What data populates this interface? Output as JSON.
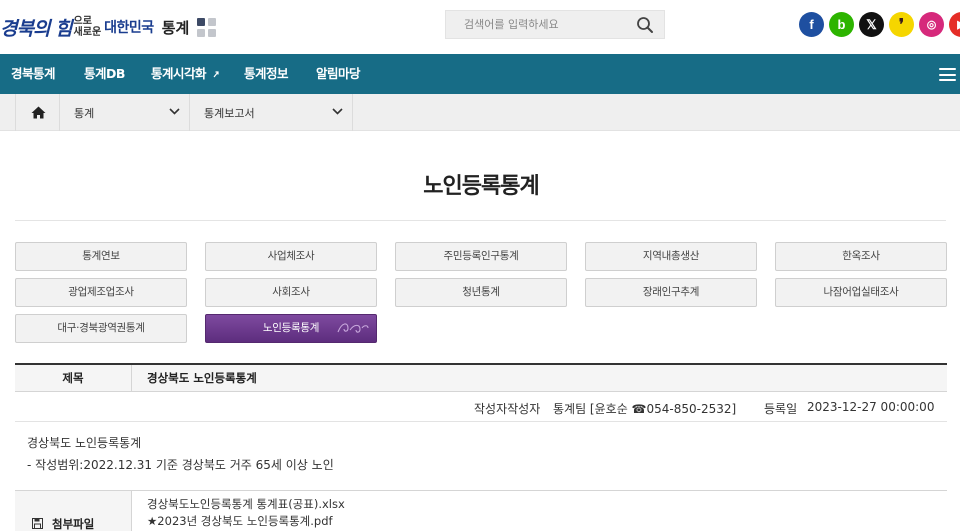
{
  "header": {
    "logo": {
      "script_text": "경북의 힘",
      "small_line1": "으로",
      "small_line2": "새로운",
      "main_text": "대한민국",
      "stat_text": "통계"
    },
    "search": {
      "placeholder": "검색어를 입력하세요"
    },
    "social": [
      {
        "name": "facebook",
        "glyph": "f",
        "color": "#1e4fa0"
      },
      {
        "name": "blog",
        "glyph": "b",
        "color": "#2db400"
      },
      {
        "name": "x",
        "glyph": "𝕏",
        "color": "#111111"
      },
      {
        "name": "kakao",
        "glyph": "❜",
        "color": "#f5d600"
      },
      {
        "name": "instagram",
        "glyph": "◎",
        "color": "#d6297b"
      },
      {
        "name": "youtube",
        "glyph": "▶",
        "color": "#e52d27"
      }
    ]
  },
  "gnb": {
    "items": [
      "경북통계",
      "통계DB",
      "통계시각화",
      "통계정보",
      "알림마당"
    ],
    "color": "#176c86"
  },
  "breadcrumb": {
    "level1": "통계",
    "level2": "통계보고서"
  },
  "page": {
    "title": "노인등록통계"
  },
  "categories": [
    "통계연보",
    "사업체조사",
    "주민등록인구통계",
    "지역내총생산",
    "한옥조사",
    "광업제조업조사",
    "사회조사",
    "청년통계",
    "장래인구추계",
    "나잠어업실태조사",
    "대구·경북광역권통계",
    "노인등록통계"
  ],
  "active_category": "노인등록통계",
  "board": {
    "title_label": "제목",
    "title_value": "경상북도 노인등록통계",
    "author_label": "작성자작성자",
    "author_value": "통계팀 [윤호순 ☎054-850-2532]",
    "date_label": "등록일",
    "date_value": "2023-12-27 00:00:00",
    "content_line1": "경상북도 노인등록통계",
    "content_line2": "- 작성범위:2022.12.31 기준 경상북도 거주 65세 이상 노인",
    "file_label": "첨부파일",
    "files": [
      "경상북도노인등록통계 통계표(공표).xlsx",
      "★2023년 경상북도 노인등록통계.pdf"
    ]
  }
}
